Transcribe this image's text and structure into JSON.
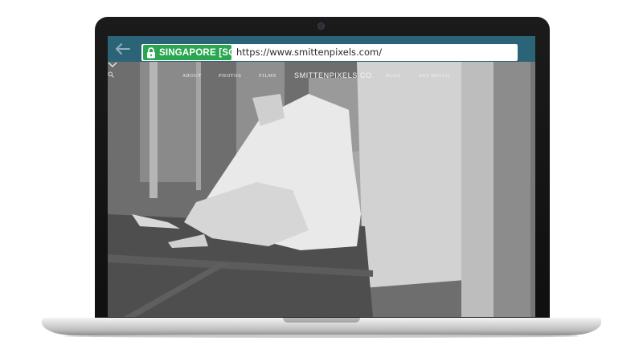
{
  "browser": {
    "back_icon": "back-arrow-icon",
    "location_badge": "SINGAPORE [SG]",
    "lock_icon": "lock-icon",
    "url": "https://www.smittenpixels.com/"
  },
  "site": {
    "nav_left": [
      "ABOUT",
      "PHOTOS",
      "FILMS"
    ],
    "brand": "SMITTENPIXELS CO.",
    "nav_right": [
      "BLOG",
      "SAY HELLO"
    ],
    "search_icon": "search-icon",
    "scroll_icon": "chevron-down-icon"
  },
  "colors": {
    "browser_bar": "#2b6377",
    "badge_green": "#2aa651"
  }
}
